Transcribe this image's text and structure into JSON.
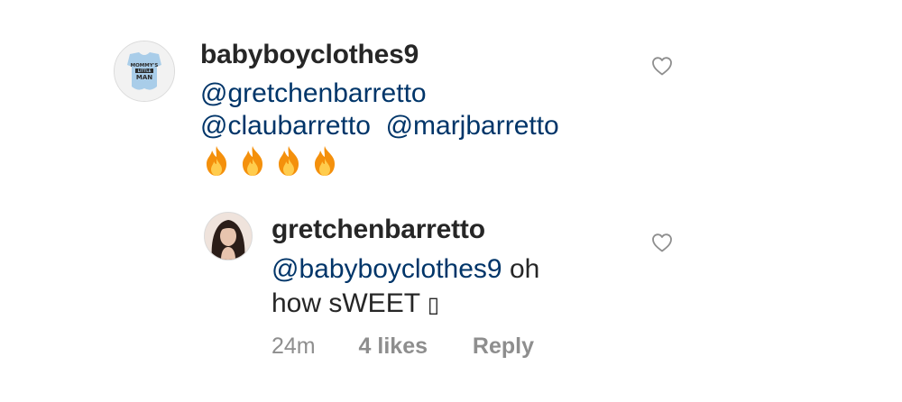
{
  "comment": {
    "username": "babyboyclothes9",
    "avatar_text": [
      "MOMMY'S",
      "LITTLE",
      "MAN"
    ],
    "line1_mention": "@gretchenbarretto",
    "line2_mention_a": "@claubarretto",
    "line2_mention_b": "@marjbarretto",
    "emojis": [
      "fire-emoji",
      "fire-emoji",
      "fire-emoji",
      "fire-emoji"
    ],
    "heart_icon": "heart-outline-icon"
  },
  "reply": {
    "username": "gretchenbarretto",
    "line1_mention": "@babyboyclothes9",
    "line1_text": " oh",
    "line2_text": "how sWEET ",
    "line2_glyph": "▯",
    "time": "24m",
    "likes": "4 likes",
    "reply_label": "Reply",
    "heart_icon": "heart-outline-icon"
  },
  "colors": {
    "mention": "#003569",
    "text": "#262626",
    "meta": "#8e8e8e"
  }
}
